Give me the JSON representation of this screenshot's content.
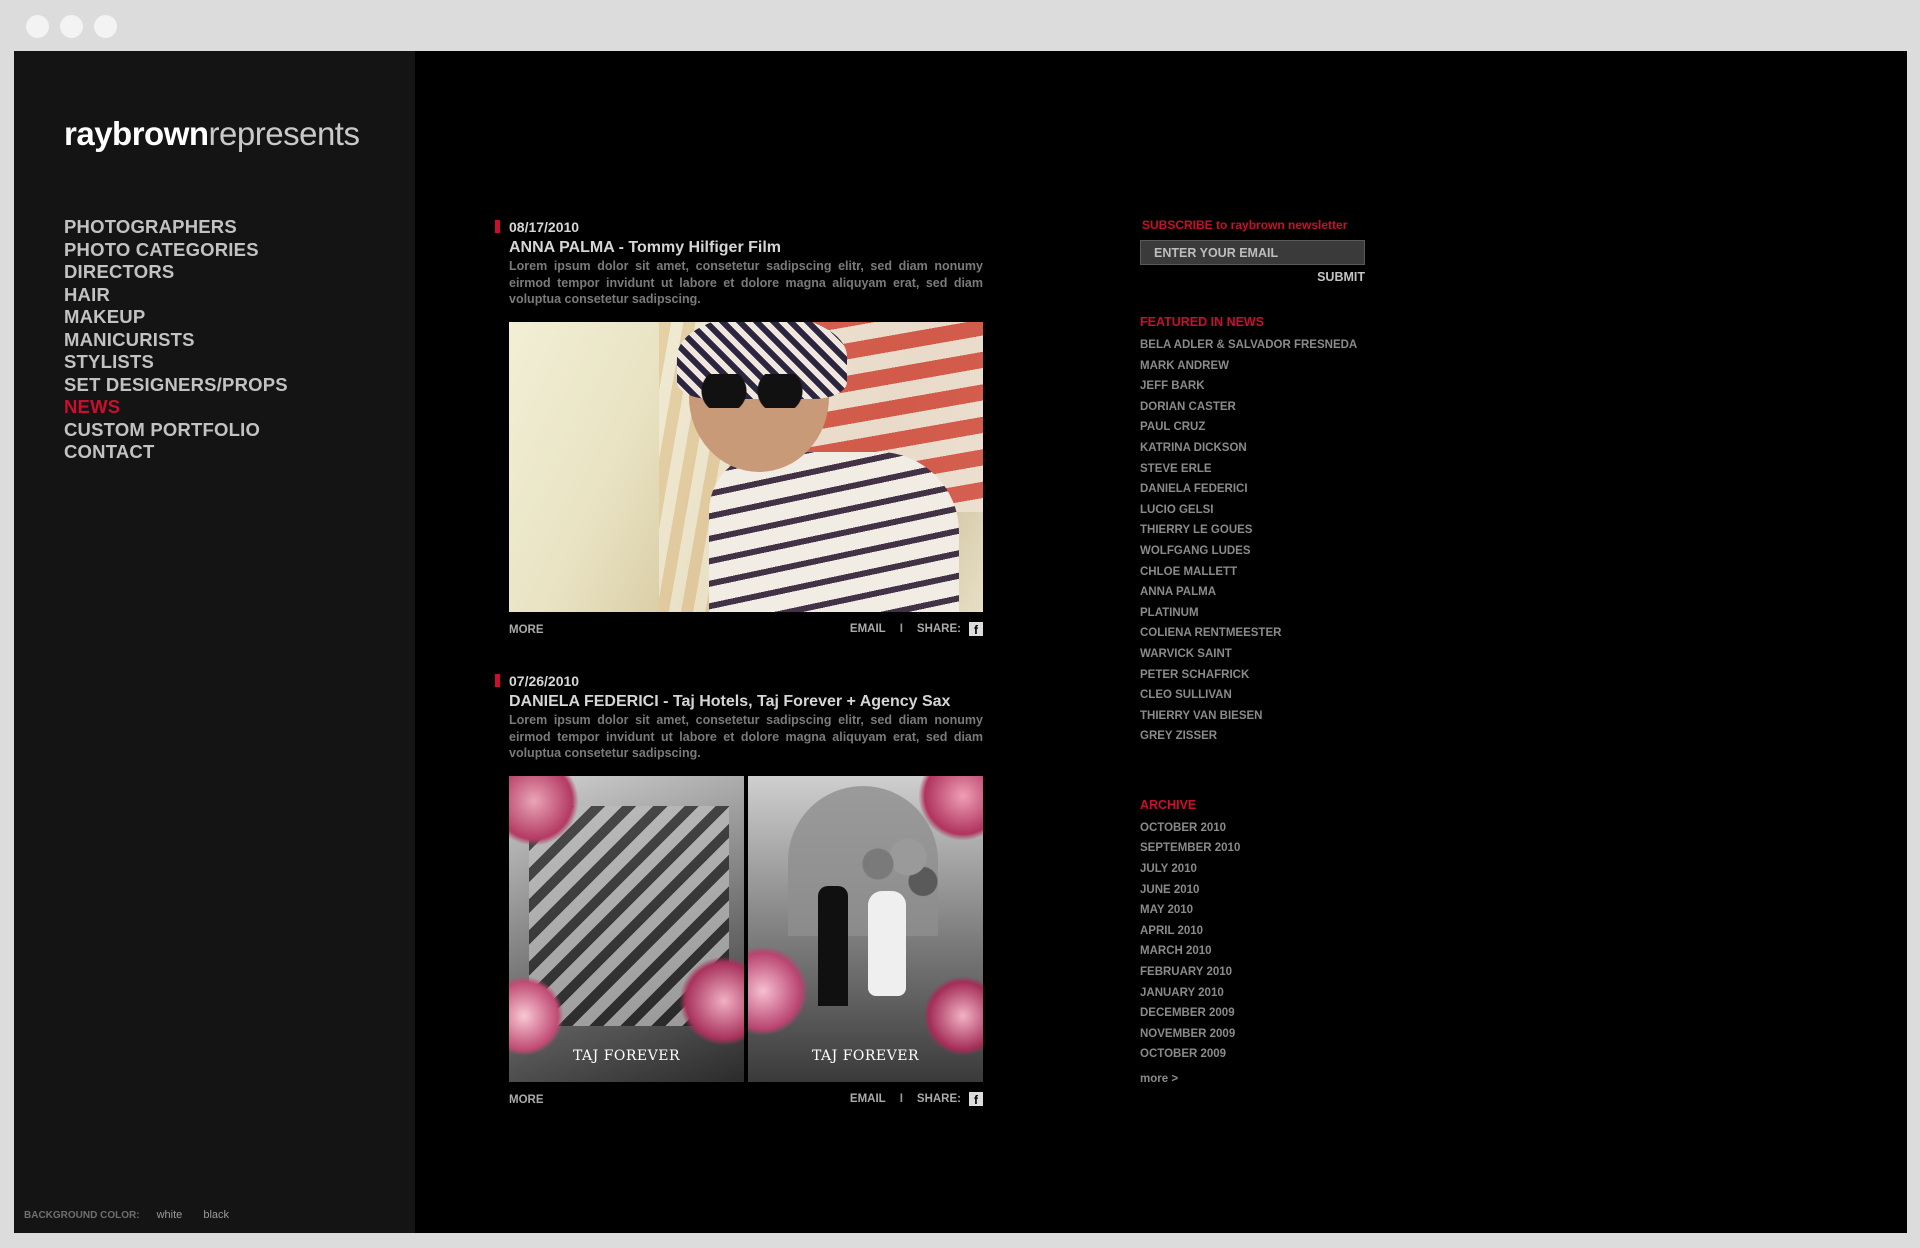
{
  "brand": {
    "part1": "raybrown",
    "part2": "represents"
  },
  "nav": {
    "items": [
      {
        "label": "PHOTOGRAPHERS"
      },
      {
        "label": "PHOTO CATEGORIES"
      },
      {
        "label": "DIRECTORS"
      },
      {
        "label": "HAIR"
      },
      {
        "label": "MAKEUP"
      },
      {
        "label": "MANICURISTS"
      },
      {
        "label": "STYLISTS"
      },
      {
        "label": "SET DESIGNERS/PROPS"
      },
      {
        "label": "NEWS",
        "active": true
      },
      {
        "label": "CUSTOM PORTFOLIO"
      },
      {
        "label": "CONTACT"
      }
    ]
  },
  "bg_color": {
    "label": "BACKGROUND COLOR:",
    "options": [
      "white",
      "black"
    ]
  },
  "posts": [
    {
      "date": "08/17/2010",
      "title": "ANNA PALMA - Tommy Hilfiger Film",
      "excerpt": "Lorem ipsum dolor sit amet, consetetur sadipscing elitr, sed diam nonumy eirmod tempor invidunt ut labore et dolore magna aliquyam erat, sed diam voluptua consetetur sadipscing.",
      "more": "MORE",
      "email": "EMAIL",
      "sep": "I",
      "share": "SHARE:"
    },
    {
      "date": "07/26/2010",
      "title": "DANIELA FEDERICI - Taj Hotels, Taj Forever  +  Agency Sax",
      "excerpt": "Lorem ipsum dolor sit amet, consetetur sadipscing elitr, sed diam nonumy eirmod tempor invidunt ut labore et dolore magna aliquyam erat, sed diam voluptua consetetur sadipscing.",
      "poster_text": "TAJ FOREVER",
      "more": "MORE",
      "email": "EMAIL",
      "sep": "I",
      "share": "SHARE:"
    }
  ],
  "subscribe": {
    "heading": "SUBSCRIBE to raybrown newsletter",
    "placeholder": "ENTER YOUR EMAIL",
    "submit": "SUBMIT"
  },
  "featured": {
    "heading": "FEATURED IN NEWS",
    "items": [
      "BELA ADLER & SALVADOR FRESNEDA",
      "MARK ANDREW",
      "JEFF BARK",
      "DORIAN CASTER",
      "PAUL CRUZ",
      "KATRINA DICKSON",
      "STEVE ERLE",
      "DANIELA FEDERICI",
      "LUCIO GELSI",
      "THIERRY LE GOUES",
      "WOLFGANG LUDES",
      "CHLOE MALLETT",
      "ANNA PALMA",
      "PLATINUM",
      "COLIENA RENTMEESTER",
      "WARVICK SAINT",
      "PETER SCHAFRICK",
      "CLEO SULLIVAN",
      "THIERRY VAN BIESEN",
      "GREY ZISSER"
    ]
  },
  "archive": {
    "heading": "ARCHIVE",
    "items": [
      "OCTOBER 2010",
      "SEPTEMBER 2010",
      "JULY 2010",
      "JUNE 2010",
      "MAY 2010",
      "APRIL 2010",
      "MARCH 2010",
      "FEBRUARY 2010",
      "JANUARY 2010",
      "DECEMBER 2009",
      "NOVEMBER 2009",
      "OCTOBER 2009"
    ],
    "more": "more >"
  },
  "colors": {
    "accent": "#c8102e",
    "sidebar_bg": "#141414",
    "main_bg": "#000000"
  }
}
